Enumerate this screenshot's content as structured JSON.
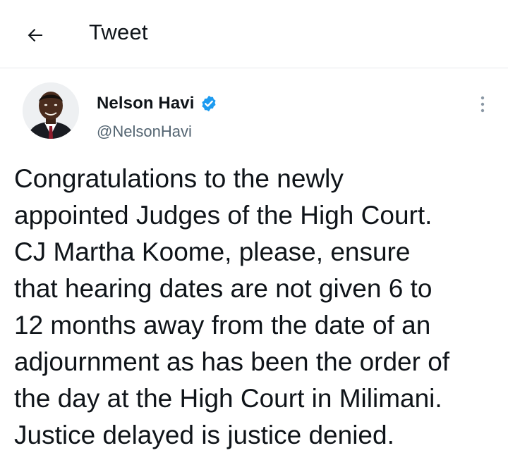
{
  "header": {
    "title": "Tweet",
    "back_icon": "arrow-left-icon"
  },
  "author": {
    "name": "Nelson Havi",
    "handle": "@NelsonHavi",
    "verified": true,
    "verified_color": "#1d9bf0"
  },
  "more_icon": "more-vertical-icon",
  "tweet": {
    "lines": [
      "Congratulations to the newly",
      "appointed Judges of the High Court.",
      "CJ Martha Koome, please, ensure",
      "that hearing dates are not given 6 to",
      "12 months away from the date of an",
      "adjournment as has been the order of",
      "the day at the High Court in Milimani.",
      "Justice delayed is justice denied."
    ]
  },
  "colors": {
    "text": "#0f1419",
    "secondary": "#536471",
    "divider": "#e6e9ec",
    "accent": "#1d9bf0"
  }
}
